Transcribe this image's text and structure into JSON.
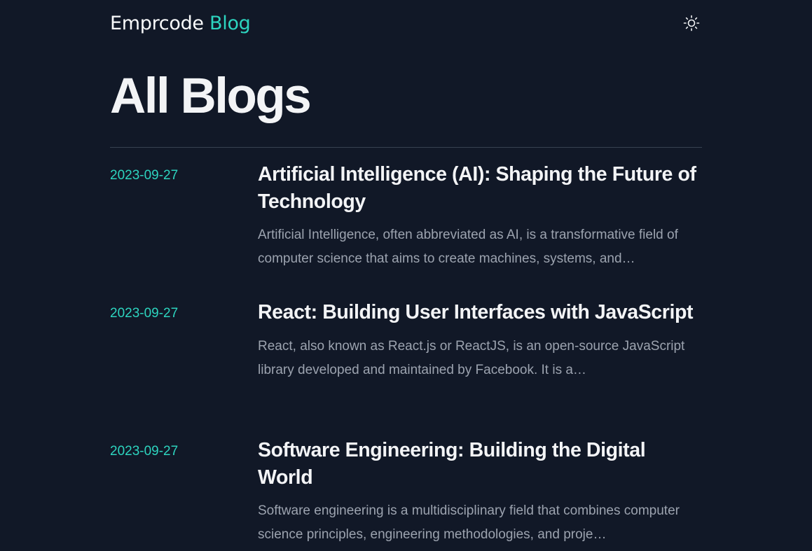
{
  "header": {
    "brand_name": "Emprcode",
    "brand_suffix": "Blog",
    "theme_toggle_icon": "sun-icon"
  },
  "page": {
    "title": "All Blogs"
  },
  "colors": {
    "background": "#111827",
    "accent": "#2dd4bf",
    "text": "#f3f4f6",
    "muted": "#9ca3af",
    "divider": "#374151"
  },
  "posts": [
    {
      "date": "2023-09-27",
      "title": "Artificial Intelligence (AI): Shaping the Future of Technology",
      "excerpt": "Artificial Intelligence, often abbreviated as AI, is a transformative field of computer science that aims to create machines, systems, and…"
    },
    {
      "date": "2023-09-27",
      "title": "React: Building User Interfaces with JavaScript",
      "excerpt": "React, also known as React.js or ReactJS, is an open-source JavaScript library developed and maintained by Facebook. It is a…"
    },
    {
      "date": "2023-09-27",
      "title": "Software Engineering: Building the Digital World",
      "excerpt": "Software engineering is a multidisciplinary field that combines computer science principles, engineering methodologies, and proje…"
    }
  ]
}
